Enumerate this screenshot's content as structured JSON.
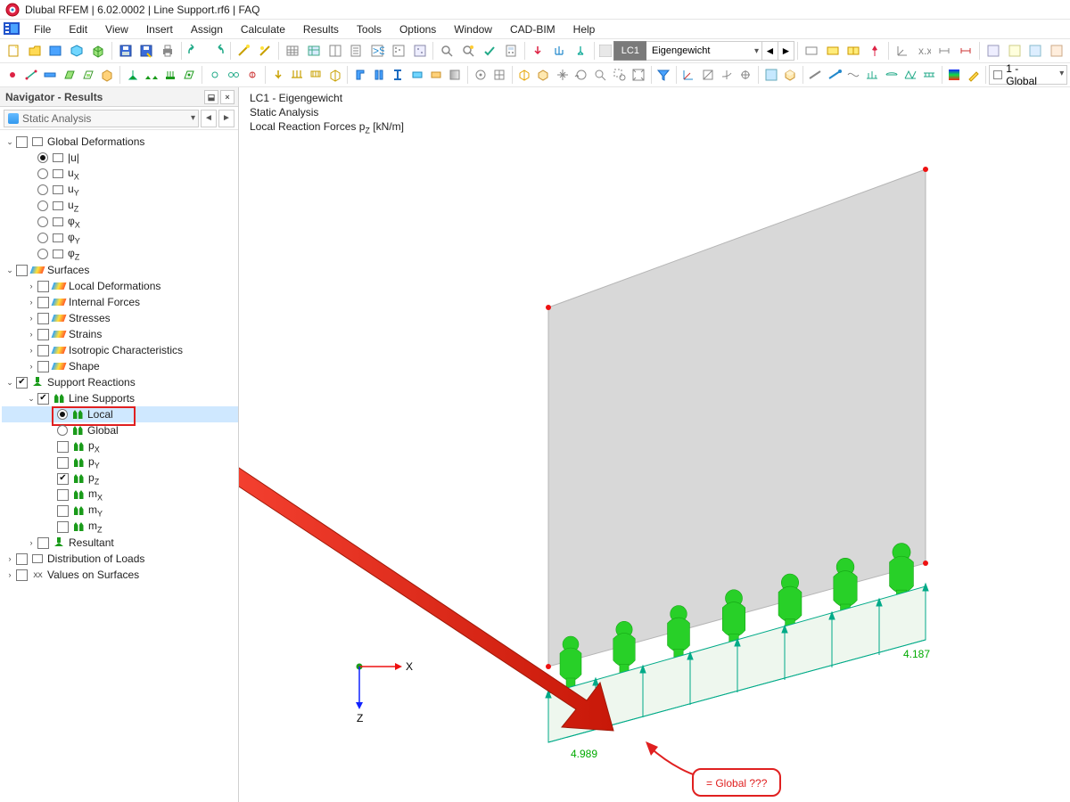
{
  "window": {
    "title": "Dlubal RFEM | 6.02.0002 | Line Support.rf6 | FAQ"
  },
  "menu": {
    "items": [
      "File",
      "Edit",
      "View",
      "Insert",
      "Assign",
      "Calculate",
      "Results",
      "Tools",
      "Options",
      "Window",
      "CAD-BIM",
      "Help"
    ]
  },
  "load_case": {
    "code": "LC1",
    "name": "Eigengewicht"
  },
  "toolbar_right": {
    "combo": "1 - Global"
  },
  "navigator": {
    "title": "Navigator - Results",
    "mode": "Static Analysis",
    "tree": {
      "global_def": {
        "label": "Global Deformations",
        "items": [
          "|u|",
          "uX",
          "uY",
          "uZ",
          "φX",
          "φY",
          "φZ"
        ],
        "selected": "|u|"
      },
      "surfaces": {
        "label": "Surfaces",
        "children": [
          "Local Deformations",
          "Internal Forces",
          "Stresses",
          "Strains",
          "Isotropic Characteristics",
          "Shape"
        ]
      },
      "support": {
        "label": "Support Reactions",
        "line_supports": {
          "label": "Line Supports",
          "radios": {
            "local": "Local",
            "global": "Global",
            "selected": "local"
          },
          "checks": [
            {
              "key": "px",
              "label": "pX",
              "checked": false
            },
            {
              "key": "py",
              "label": "pY",
              "checked": false
            },
            {
              "key": "pz",
              "label": "pZ",
              "checked": true
            },
            {
              "key": "mx",
              "label": "mX",
              "checked": false
            },
            {
              "key": "my",
              "label": "mY",
              "checked": false
            },
            {
              "key": "mz",
              "label": "mZ",
              "checked": false
            }
          ]
        },
        "resultant": "Resultant"
      },
      "dist_loads": "Distribution of Loads",
      "values_surf": "Values on Surfaces"
    }
  },
  "viewport": {
    "header": {
      "line1": "LC1 - Eigengewicht",
      "line2": "Static Analysis",
      "line3": "Local Reaction Forces pZ [kN/m]"
    },
    "axes": {
      "x": "X",
      "z": "Z"
    },
    "values": {
      "left": "4.989",
      "right": "4.187"
    },
    "callout": "= Global ???"
  }
}
